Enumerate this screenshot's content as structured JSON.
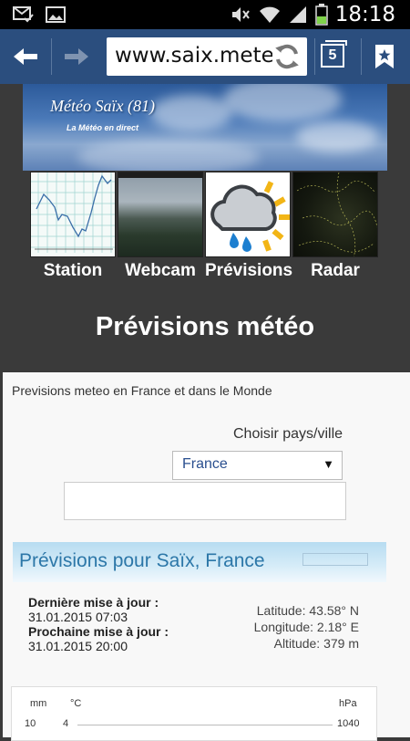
{
  "status_bar": {
    "time": "18:18"
  },
  "browser": {
    "url": "www.saix.meteo",
    "tab_count": "5"
  },
  "banner": {
    "title": "Météo Saïx (81)",
    "subtitle": "La Météo en direct"
  },
  "nav": [
    {
      "label": "Station"
    },
    {
      "label": "Webcam"
    },
    {
      "label": "Prévisions"
    },
    {
      "label": "Radar"
    }
  ],
  "page": {
    "title": "Prévisions météo"
  },
  "panel": {
    "intro": "Previsions meteo en France et dans le Monde",
    "choose_label": "Choisir pays/ville",
    "country_selected": "France",
    "city_value": ""
  },
  "forecast": {
    "heading": "Prévisions pour Saïx, France",
    "last_update_label": "Dernière mise à jour :",
    "last_update_value": "31.01.2015 07:03",
    "next_update_label": "Prochaine mise à jour :",
    "next_update_value": "31.01.2015 20:00",
    "latitude": "Latitude: 43.58° N",
    "longitude": "Longitude: 2.18° E",
    "altitude": "Altitude: 379 m"
  },
  "chart": {
    "unit_mm": "mm",
    "unit_c": "°C",
    "unit_hpa": "hPa",
    "tick_mm": "10",
    "tick_c": "4",
    "tick_hpa": "1040"
  },
  "colors": {
    "toolbar": "#2b4e7e",
    "page_bg": "#3a3a3a",
    "accent": "#2c77a8"
  }
}
